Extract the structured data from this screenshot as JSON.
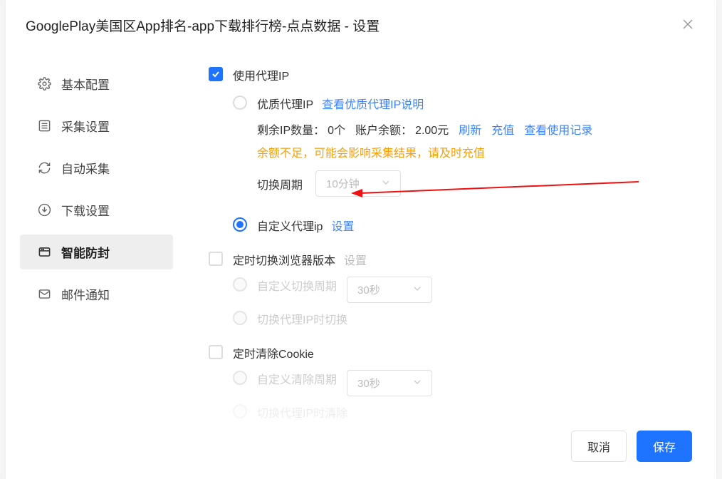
{
  "header": {
    "title": "GooglePlay美国区App排名-app下载排行榜-点点数据 - 设置"
  },
  "sidebar": {
    "items": [
      {
        "label": "基本配置",
        "icon": "gear-icon"
      },
      {
        "label": "采集设置",
        "icon": "list-icon"
      },
      {
        "label": "自动采集",
        "icon": "refresh-icon"
      },
      {
        "label": "下载设置",
        "icon": "download-icon"
      },
      {
        "label": "智能防封",
        "icon": "shield-icon"
      },
      {
        "label": "邮件通知",
        "icon": "mail-icon"
      }
    ],
    "activeIndex": 4
  },
  "content": {
    "useProxy": {
      "label": "使用代理IP"
    },
    "premiumProxy": {
      "label": "优质代理IP",
      "link": "查看优质代理IP说明",
      "remainPrefix": "剩余IP数量：",
      "remainValue": "0个",
      "balancePrefix": "账户余额：",
      "balanceValue": "2.00元",
      "refresh": "刷新",
      "recharge": "充值",
      "viewLog": "查看使用记录",
      "warning": "余额不足，可能会影响采集结果，请及时充值",
      "cycleLabel": "切换周期",
      "cycleValue": "10分钟"
    },
    "customProxy": {
      "label": "自定义代理ip",
      "link": "设置"
    },
    "switchBrowser": {
      "label": "定时切换浏览器版本",
      "link": "设置",
      "customCycleLabel": "自定义切换周期",
      "customCycleValue": "30秒",
      "switchOnProxyLabel": "切换代理IP时切换"
    },
    "clearCookie": {
      "label": "定时清除Cookie",
      "customLabel": "自定义清除周期",
      "customValue": "30秒",
      "onProxyLabel": "切换代理IP时清除"
    }
  },
  "footer": {
    "cancel": "取消",
    "save": "保存"
  }
}
